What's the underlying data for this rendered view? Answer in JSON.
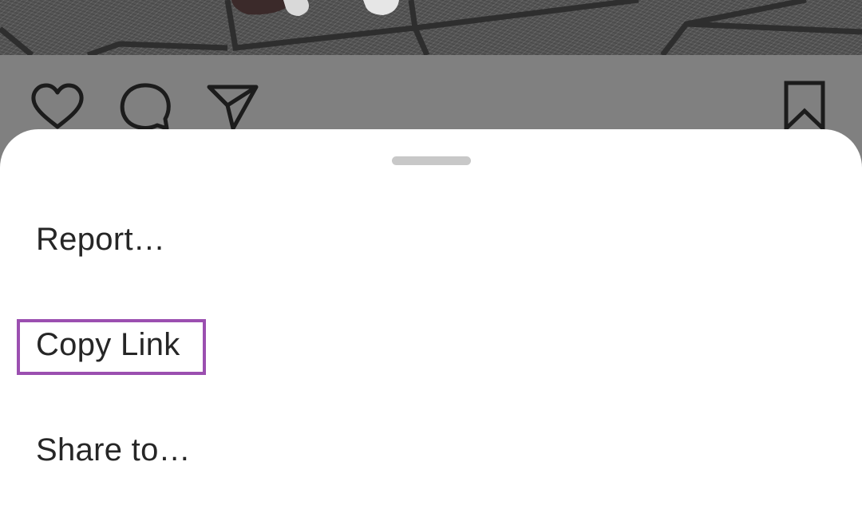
{
  "photo": {
    "icon": "pavement-photo"
  },
  "actions": {
    "like_icon": "heart-outline-icon",
    "comment_icon": "comment-bubble-icon",
    "share_icon": "paper-plane-icon",
    "save_icon": "bookmark-outline-icon"
  },
  "sheet": {
    "handle_icon": "drag-handle",
    "items": [
      {
        "label": "Report…"
      },
      {
        "label": "Copy Link",
        "highlighted": true
      },
      {
        "label": "Share to…"
      }
    ]
  },
  "colors": {
    "dim_overlay": "#808080",
    "sheet_background": "#ffffff",
    "text": "#262626",
    "handle": "#c8c8c8",
    "highlight": "#9b4fb0",
    "icon_stroke": "#1c1c1c"
  }
}
